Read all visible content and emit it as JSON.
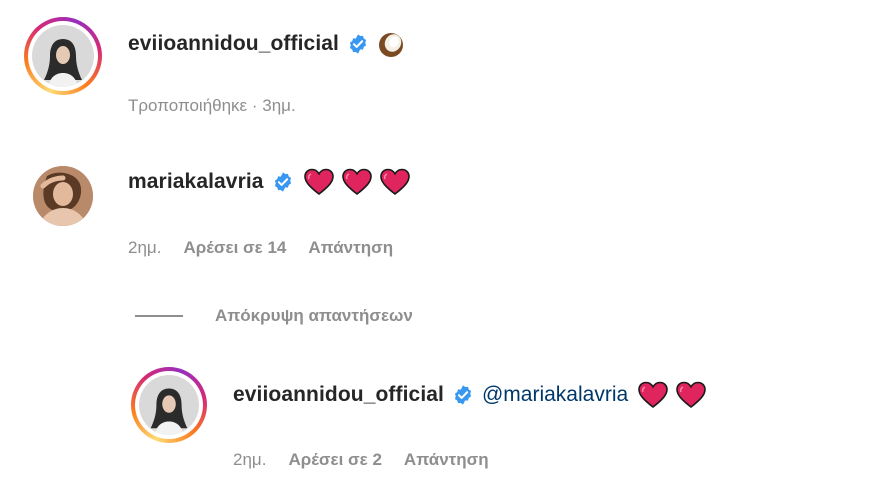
{
  "comments": [
    {
      "username": "eviioannidou_official",
      "verified": true,
      "emoji": [
        "coconut-emoji"
      ],
      "meta": "Τροποποιήθηκε · 3ημ."
    },
    {
      "username": "mariakalavria",
      "verified": true,
      "emoji": [
        "red-heart-emoji",
        "red-heart-emoji",
        "red-heart-emoji"
      ],
      "time": "2ημ.",
      "likes": "Αρέσει σε 14",
      "reply": "Απάντηση"
    }
  ],
  "hide_replies": "Απόκρυψη απαντήσεων",
  "reply": {
    "username": "eviioannidou_official",
    "verified": true,
    "mention": "@mariakalavria",
    "emoji": [
      "red-heart-emoji",
      "red-heart-emoji"
    ],
    "time": "2ημ.",
    "likes": "Αρέσει σε 2",
    "reply": "Απάντηση"
  },
  "colors": {
    "text": "#262626",
    "muted": "#8e8e8e",
    "verified": "#3897f0",
    "mention": "#00376b",
    "heart": "#e0245e"
  }
}
